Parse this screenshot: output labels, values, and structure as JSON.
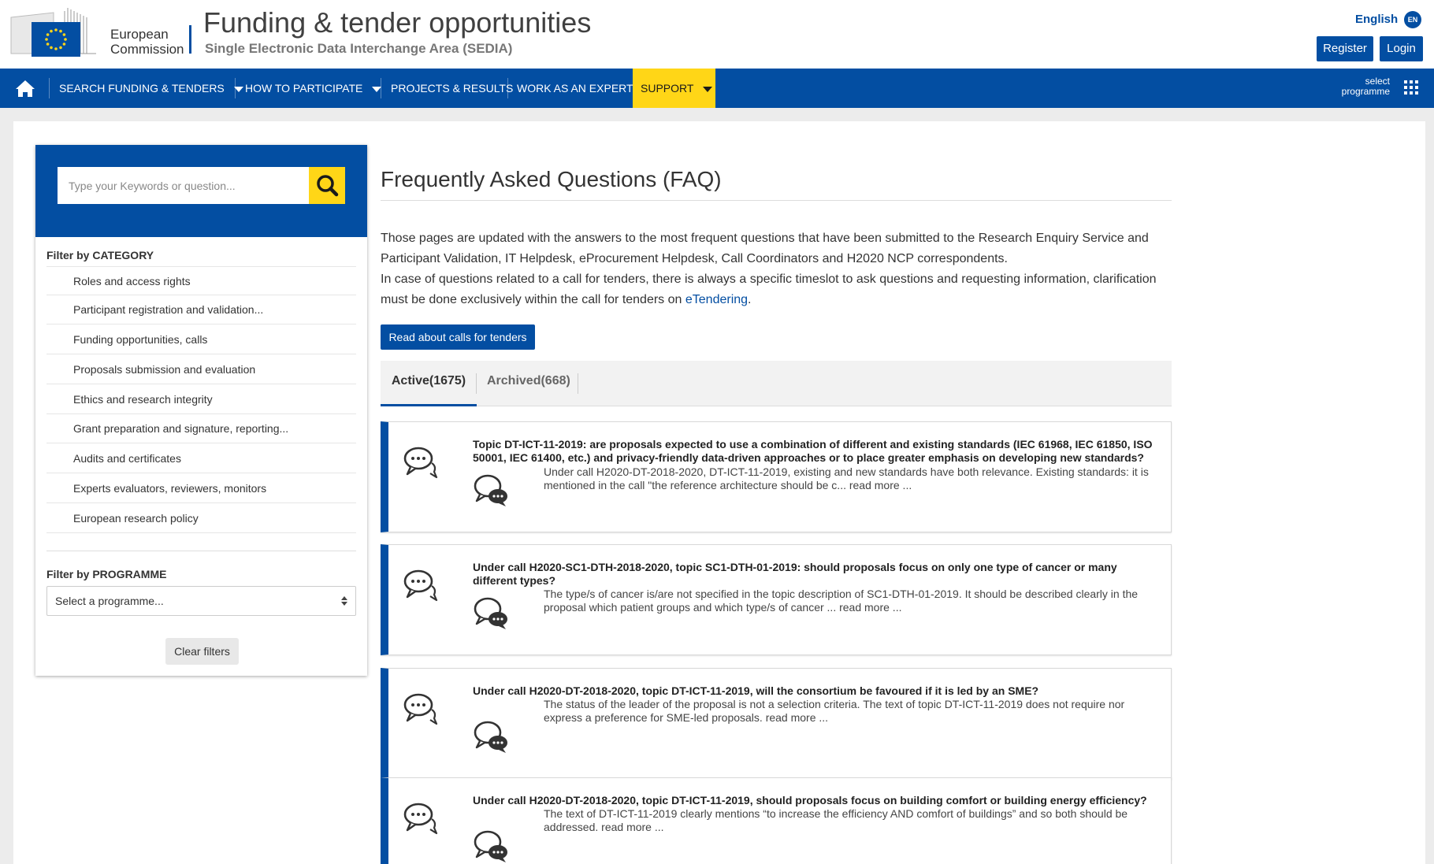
{
  "header": {
    "org_line1": "European",
    "org_line2": "Commission",
    "title": "Funding & tender opportunities",
    "subtitle": "Single Electronic Data Interchange Area (SEDIA)",
    "language": "English",
    "language_code": "EN",
    "register_label": "Register",
    "login_label": "Login"
  },
  "nav": {
    "items": [
      {
        "label": "SEARCH FUNDING & TENDERS",
        "has_dropdown": true
      },
      {
        "label": "HOW TO PARTICIPATE",
        "has_dropdown": true
      },
      {
        "label": "PROJECTS & RESULTS",
        "has_dropdown": false
      },
      {
        "label": "WORK AS AN EXPERT",
        "has_dropdown": false
      },
      {
        "label": "SUPPORT",
        "has_dropdown": true,
        "active": true
      }
    ],
    "select_programme_line1": "select",
    "select_programme_line2": "programme"
  },
  "sidebar": {
    "search_placeholder": "Type your Keywords or question...",
    "category_title": "Filter by CATEGORY",
    "categories": [
      "Roles and access rights",
      "Participant registration and validation...",
      "Funding opportunities, calls",
      "Proposals submission and evaluation",
      "Ethics and research integrity",
      "Grant preparation and signature, reporting...",
      "Audits and certificates",
      "Experts evaluators, reviewers, monitors",
      "European research policy"
    ],
    "programme_title": "Filter by PROGRAMME",
    "programme_value": "Select a programme...",
    "clear_label": "Clear filters"
  },
  "content": {
    "title": "Frequently Asked Questions (FAQ)",
    "intro_p1": "Those pages are updated with the answers to the most frequent questions that have been submitted to the Research Enquiry Service and Participant Validation, IT Helpdesk, eProcurement Helpdesk, Call Coordinators and H2020 NCP correspondents.",
    "intro_p2_before": "In case of questions related to a call for tenders, there is always a specific timeslot to ask questions and requesting information, clarification must be done exclusively within the call for tenders on ",
    "intro_p2_link": "eTendering",
    "intro_p2_after": ".",
    "read_button": "Read about calls for tenders",
    "tabs": [
      {
        "label": "Active(1675)",
        "active": true
      },
      {
        "label": "Archived(668)",
        "active": false
      }
    ],
    "faqs": [
      {
        "question": "Topic DT-ICT-11-2019: are proposals expected to use a combination of different and existing standards (IEC 61968, IEC 61850, ISO 50001, IEC 61400, etc.) and privacy-friendly data-driven approaches or to place greater emphasis on developing new standards?",
        "answer": "Under call H2020-DT-2018-2020, DT-ICT-11-2019, existing and new standards have both relevance. Existing standards: it is mentioned in the call \"the reference architecture should be c... read more ..."
      },
      {
        "question": "Under call H2020-SC1-DTH-2018-2020, topic SC1-DTH-01-2019: should proposals focus on only one type of cancer or many different types?",
        "answer": "The type/s of cancer is/are not specified in the topic description of SC1-DTH-01-2019. It should be described clearly in the proposal which patient groups and which type/s of cancer ... read more ..."
      },
      {
        "question": "Under call H2020-DT-2018-2020, topic DT-ICT-11-2019, will the consortium be favoured if it is led by an SME?",
        "answer": "The status of the leader of the proposal is not a selection criteria. The text of topic DT-ICT-11-2019 does not require nor express a preference for SME-led proposals. read more ..."
      },
      {
        "question": "Under call H2020-DT-2018-2020, topic DT-ICT-11-2019, should proposals focus on building comfort or building energy efficiency?",
        "answer": "The text of DT-ICT-11-2019 clearly mentions “to increase the efficiency AND comfort of buildings” and so both should be addressed. read more ..."
      }
    ]
  },
  "colors": {
    "primary": "#034ea2",
    "accent": "#ffd617"
  }
}
